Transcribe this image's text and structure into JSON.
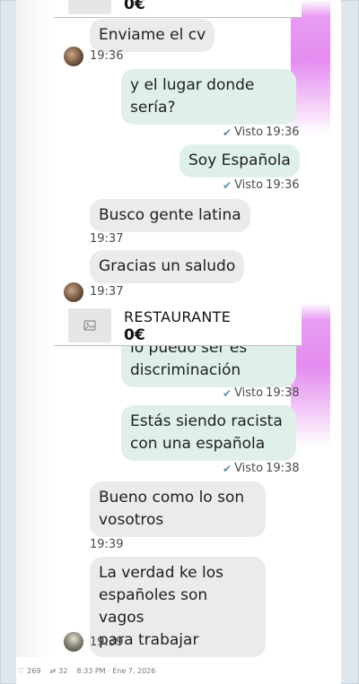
{
  "listing_top": {
    "price": "0€"
  },
  "messages_1": {
    "m1": {
      "text": "Enviame el cv",
      "time": "19:36"
    },
    "m2": {
      "text1": "y el lugar donde",
      "text2": "sería?",
      "status": "Visto",
      "time": "19:36"
    },
    "m3": {
      "text": "Soy Española",
      "status": "Visto",
      "time": "19:36"
    },
    "m4": {
      "text": "Busco gente latina",
      "time": "19:37"
    },
    "m5": {
      "text": "Gracias un saludo",
      "time": "19:37"
    }
  },
  "listing": {
    "title": "RESTAURANTE",
    "price": "0€"
  },
  "messages_2": {
    "m1": {
      "text_partial": "lo puedo ser es",
      "text": "discriminación",
      "status": "Visto",
      "time": "19:38"
    },
    "m2": {
      "text1": "Estás siendo racista",
      "text2": "con una española",
      "status": "Visto",
      "time": "19:38"
    },
    "m3": {
      "text1": "Bueno como lo son",
      "text2": "vosotros",
      "time": "19:39"
    },
    "m4": {
      "text1": "La verdad ke los",
      "text2": "españoles son vagos",
      "text3": "para trabajar",
      "time": "19:39"
    }
  },
  "footer": {
    "likes": "269",
    "retweets": "32",
    "timestamp": "8:33 PM · Ene 7, 2026"
  },
  "icons": {
    "check": "double-check-icon",
    "image": "image-placeholder-icon",
    "heart": "heart-icon",
    "retweet": "retweet-icon"
  },
  "colors": {
    "incoming": "#ebebeb",
    "outgoing": "#dff0e8",
    "accent_pink": "#e48cf0"
  }
}
